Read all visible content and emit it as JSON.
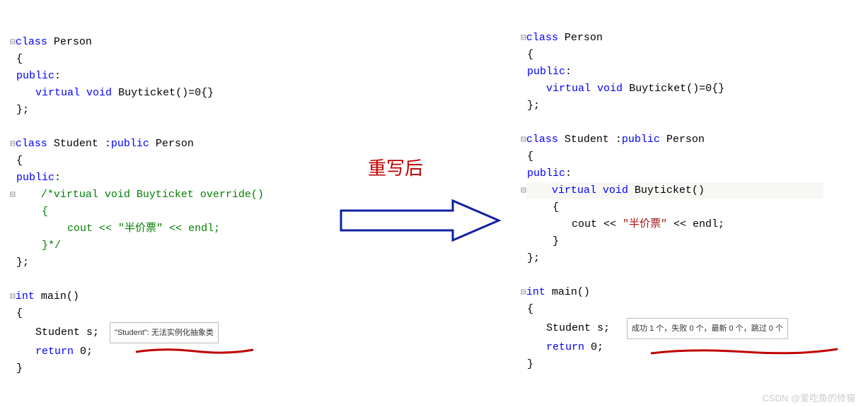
{
  "left": {
    "l1": "class",
    "l1b": " Person",
    "l2": "{",
    "l3": "public",
    "l3b": ":",
    "l4a": "    ",
    "l4b": "virtual",
    "l4c": " ",
    "l4d": "void",
    "l4e": " Buyticket()=0{}",
    "l5": "};",
    "blank1": "",
    "l6": "class",
    "l6b": " Student :",
    "l6c": "public",
    "l6d": " Person",
    "l7": "{",
    "l8": "public",
    "l8b": ":",
    "cmt_open": "    /*virtual void Buyticket override()",
    "cmt_l2": "    {",
    "cmt_l3a": "        cout << ",
    "cmt_l3str": "\"半价票\"",
    "cmt_l3c": " << endl;",
    "cmt_close": "    }*/",
    "l13": "};",
    "blank2": "",
    "l14": "int",
    "l14b": " main()",
    "l15": "{",
    "l16": "    Student s;",
    "tooltip": "\"Student\": 无法实例化抽象类",
    "l17a": "    ",
    "l17b": "return",
    "l17c": " 0;",
    "l18": "}"
  },
  "right": {
    "l1": "class",
    "l1b": " Person",
    "l2": "{",
    "l3": "public",
    "l3b": ":",
    "l4a": "    ",
    "l4b": "virtual",
    "l4c": " ",
    "l4d": "void",
    "l4e": " Buyticket()=0{}",
    "l5": "};",
    "blank1": "",
    "l6": "class",
    "l6b": " Student :",
    "l6c": "public",
    "l6d": " Person",
    "l7": "{",
    "l8": "public",
    "l8b": ":",
    "l9a": "    ",
    "l9b": "virtual",
    "l9c": " ",
    "l9d": "void",
    "l9e": " Buyticket()",
    "l10": "    {",
    "l11a": "        cout << ",
    "l11str": "\"半价票\"",
    "l11c": " << endl;",
    "l12": "    }",
    "l13": "};",
    "blank2": "",
    "l14": "int",
    "l14b": " main()",
    "l15": "{",
    "l16": "    Student s;",
    "tooltip": "成功 1 个，失败 0 个，最新 0 个，跳过 0 个",
    "l17a": "    ",
    "l17b": "return",
    "l17c": " 0;",
    "l18": "}"
  },
  "arrow_label": "重写后",
  "watermark": "CSDN @爱吃鱼的修猫"
}
